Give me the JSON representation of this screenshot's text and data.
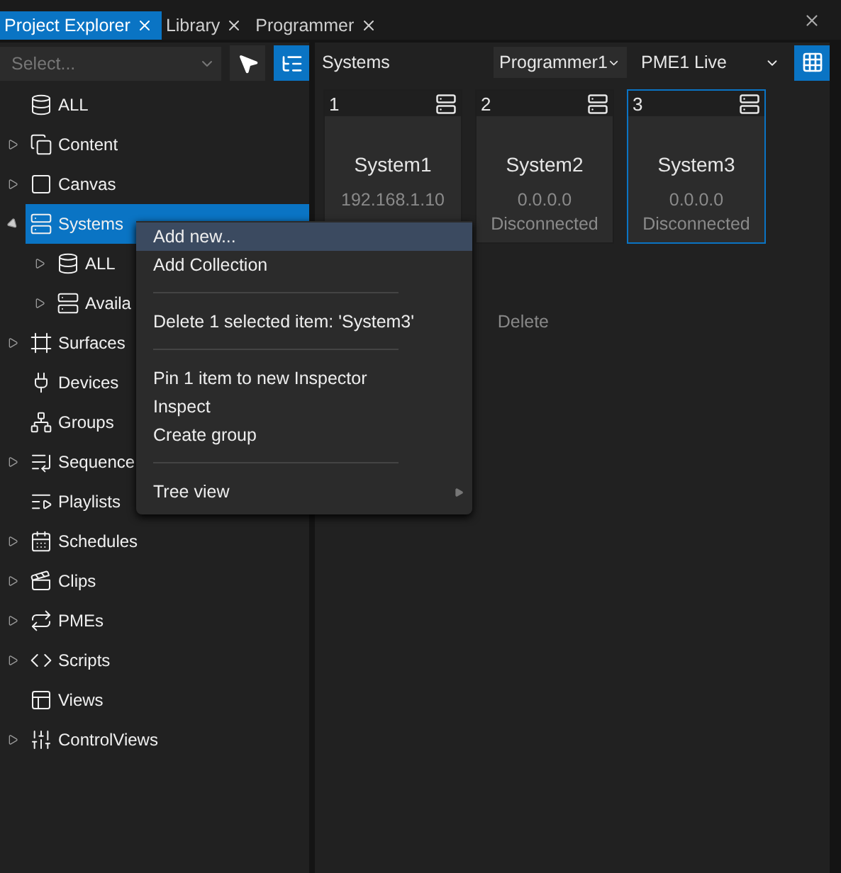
{
  "tabs": [
    {
      "label": "Project Explorer",
      "selected": true
    },
    {
      "label": "Library",
      "selected": false
    },
    {
      "label": "Programmer",
      "selected": false
    }
  ],
  "explorer": {
    "select": {
      "placeholder": "Select..."
    },
    "pointer_tool": {
      "on": false
    },
    "tree_tool": {
      "on": true
    },
    "tree": [
      {
        "label": "ALL",
        "expandable": false,
        "selected": false
      },
      {
        "label": "Content",
        "expandable": true,
        "expanded": false,
        "selected": false
      },
      {
        "label": "Canvas",
        "expandable": true,
        "expanded": false,
        "selected": false
      },
      {
        "label": "Systems",
        "expandable": true,
        "expanded": true,
        "selected": true,
        "children": [
          {
            "label": "ALL",
            "expandable": true,
            "expanded": false,
            "selected": false
          },
          {
            "label": "Availa",
            "expandable": true,
            "expanded": false,
            "selected": false
          }
        ]
      },
      {
        "label": "Surfaces",
        "expandable": true,
        "expanded": false,
        "selected": false
      },
      {
        "label": "Devices",
        "expandable": false,
        "selected": false
      },
      {
        "label": "Groups",
        "expandable": false,
        "selected": false
      },
      {
        "label": "Sequence",
        "expandable": true,
        "expanded": false,
        "selected": false
      },
      {
        "label": "Playlists",
        "expandable": false,
        "selected": false
      },
      {
        "label": "Schedules",
        "expandable": true,
        "expanded": false,
        "selected": false
      },
      {
        "label": "Clips",
        "expandable": true,
        "expanded": false,
        "selected": false
      },
      {
        "label": "PMEs",
        "expandable": true,
        "expanded": false,
        "selected": false
      },
      {
        "label": "Scripts",
        "expandable": true,
        "expanded": false,
        "selected": false
      },
      {
        "label": "Views",
        "expandable": false,
        "selected": false
      },
      {
        "label": "ControlViews",
        "expandable": true,
        "expanded": false,
        "selected": false
      }
    ]
  },
  "systems_panel": {
    "title": "Systems",
    "programmer": "Programmer1",
    "pme": "PME1 Live",
    "grid_view": {
      "on": true
    },
    "cards": [
      {
        "number": "1",
        "name": "System1",
        "address": "192.168.1.10",
        "selected": false
      },
      {
        "number": "2",
        "name": "System2",
        "address": "0.0.0.0",
        "status": "Disconnected",
        "selected": false
      },
      {
        "number": "3",
        "name": "System3",
        "address": "0.0.0.0",
        "status": "Disconnected",
        "selected": true
      }
    ]
  },
  "context_menu": [
    {
      "kind": "item",
      "label": "Add new...",
      "selected": true
    },
    {
      "kind": "item",
      "label": "Add Collection",
      "selected": false
    },
    {
      "kind": "separator"
    },
    {
      "kind": "item",
      "label": "Delete 1 selected item: 'System3'",
      "shortcut": "Delete",
      "selected": false
    },
    {
      "kind": "separator"
    },
    {
      "kind": "item",
      "label": "Pin 1 item to new Inspector",
      "selected": false
    },
    {
      "kind": "item",
      "label": "Inspect",
      "selected": false
    },
    {
      "kind": "item",
      "label": "Create group",
      "selected": false
    },
    {
      "kind": "separator"
    },
    {
      "kind": "submenu",
      "label": "Tree view",
      "selected": false
    }
  ]
}
